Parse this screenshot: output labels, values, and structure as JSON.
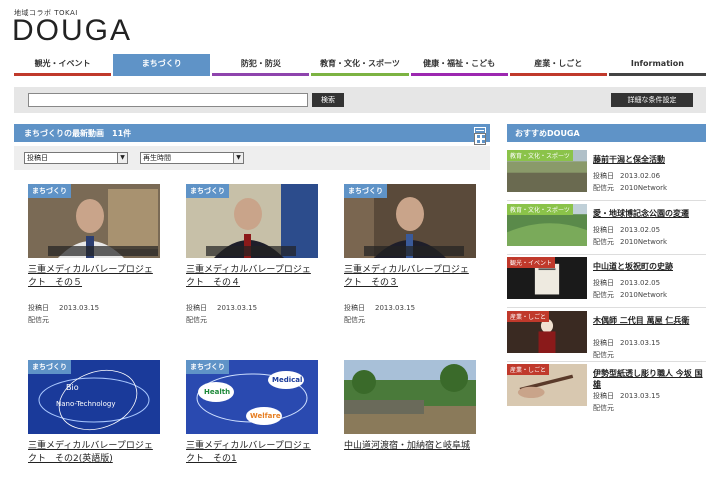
{
  "header": {
    "logo_sub": "地域コラボ TOKAI",
    "logo": "DOUGA"
  },
  "nav": [
    {
      "label": "観光・イベント",
      "color": "#c0392b",
      "active": false
    },
    {
      "label": "まちづくり",
      "color": "#5f93c7",
      "active": true
    },
    {
      "label": "防犯・防災",
      "color": "#8e44ad",
      "active": false
    },
    {
      "label": "教育・文化・スポーツ",
      "color": "#7cb342",
      "active": false
    },
    {
      "label": "健康・福祉・こども",
      "color": "#9c27b0",
      "active": false
    },
    {
      "label": "産業・しごと",
      "color": "#c0392b",
      "active": false
    },
    {
      "label": "Information",
      "color": "#444444",
      "active": false
    }
  ],
  "search": {
    "value": "",
    "button": "検索",
    "detail_button": "詳細な条件設定"
  },
  "main": {
    "heading": "まちづくりの最新動画　11件",
    "sort_select": "投稿日",
    "time_select": "再生時間"
  },
  "labels": {
    "posted": "投稿日",
    "source": "配信元"
  },
  "videos": [
    {
      "tag": "まちづくり",
      "title": "三重メディカルバレープロジェクト　その５",
      "date": "2013.03.15",
      "thumb": "man1"
    },
    {
      "tag": "まちづくり",
      "title": "三重メディカルバレープロジェクト　その４",
      "date": "2013.03.15",
      "thumb": "man2"
    },
    {
      "tag": "まちづくり",
      "title": "三重メディカルバレープロジェクト　その３",
      "date": "2013.03.15",
      "thumb": "man3"
    },
    {
      "tag": "まちづくり",
      "title": "三重メディカルバレープロジェクト　その2(英語版)",
      "thumb": "bio"
    },
    {
      "tag": "まちづくり",
      "title": "三重メディカルバレープロジェクト　その1",
      "thumb": "health"
    },
    {
      "tag": "",
      "title": "中山道河渡宿・加納宿と岐阜城",
      "thumb": "castle"
    }
  ],
  "sidebar": {
    "heading": "おすすめDOUGA",
    "items": [
      {
        "tag": "教育・文化・スポーツ",
        "tag_color": "#8bc34a",
        "title": "藤前干潟と保全活動",
        "date": "2013.02.06",
        "source": "2010Network",
        "thumb": "wetland"
      },
      {
        "tag": "教育・文化・スポーツ",
        "tag_color": "#8bc34a",
        "title": "愛・地球博記念公園の変遷",
        "date": "2013.02.05",
        "source": "2010Network",
        "thumb": "park"
      },
      {
        "tag": "観光・イベント",
        "tag_color": "#c0392b",
        "title": "中山道と坂祝町の史跡",
        "date": "2013.02.05",
        "source": "2010Network",
        "thumb": "book"
      },
      {
        "tag": "産業・しごと",
        "tag_color": "#c0392b",
        "title": "木偶師 二代目 萬屋 仁兵衛",
        "date": "2013.03.15",
        "thumb": "doll"
      },
      {
        "tag": "産業・しごと",
        "tag_color": "#c0392b",
        "title": "伊勢型紙透し彫り職人 今坂 国雄",
        "date": "2013.03.15",
        "thumb": "craft"
      }
    ]
  }
}
